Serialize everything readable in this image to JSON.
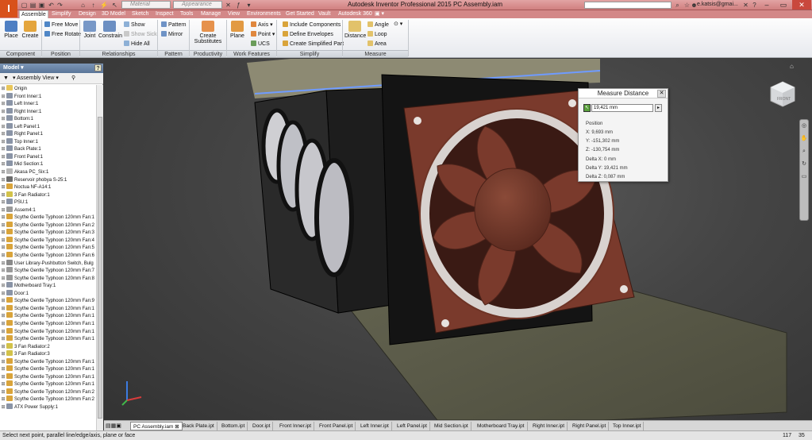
{
  "titlebar": {
    "title": "Autodesk Inventor Professional 2015   PC Assembly.iam",
    "material_placeholder": "Material",
    "appearance_placeholder": "Appearance",
    "user": "e.katsis@gmai...",
    "logo": "I"
  },
  "tabs": [
    "Assemble",
    "Simplify",
    "Design",
    "3D Model",
    "Sketch",
    "Inspect",
    "Tools",
    "Manage",
    "View",
    "Environments",
    "Get Started",
    "Vault",
    "Autodesk 360"
  ],
  "ribbon": {
    "place": "Place",
    "create": "Create",
    "free_move": "Free Move",
    "free_rotate": "Free Rotate",
    "joint": "Joint",
    "constrain": "Constrain",
    "show": "Show",
    "show_sick": "Show Sick",
    "hide_all": "Hide All",
    "pattern": "Pattern",
    "mirror": "Mirror",
    "create_substitutes_1": "Create",
    "create_substitutes_2": "Substitutes",
    "plane": "Plane",
    "axis": "Axis",
    "point": "Point",
    "ucs": "UCS",
    "include_components": "Include Components",
    "define_envelopes": "Define Envelopes",
    "create_simplified_part": "Create Simplified Part",
    "distance": "Distance",
    "angle": "Angle",
    "loop": "Loop",
    "area": "Area",
    "panels": {
      "component": "Component",
      "position": "Position",
      "relationships": "Relationships",
      "pattern": "Pattern",
      "productivity": "Productivity",
      "work_features": "Work Features",
      "simplify": "Simplify",
      "measure": "Measure"
    }
  },
  "browser": {
    "header": "Model",
    "view": "Assembly View",
    "help": "?",
    "nodes": [
      {
        "label": "Origin",
        "color": "#e8c65a"
      },
      {
        "label": "Front Inner:1",
        "color": "#8a94a6"
      },
      {
        "label": "Left Inner:1",
        "color": "#8a94a6"
      },
      {
        "label": "Right Inner:1",
        "color": "#8a94a6"
      },
      {
        "label": "Bottom:1",
        "color": "#8a94a6"
      },
      {
        "label": "Left Panel:1",
        "color": "#8a94a6"
      },
      {
        "label": "Right Panel:1",
        "color": "#8a94a6"
      },
      {
        "label": "Top Inner:1",
        "color": "#8a94a6"
      },
      {
        "label": "Back Plate:1",
        "color": "#8a94a6"
      },
      {
        "label": "Front Panel:1",
        "color": "#8a94a6"
      },
      {
        "label": "Mid Section:1",
        "color": "#8a94a6"
      },
      {
        "label": "Akasa PC_Six:1",
        "color": "#b7b7b7"
      },
      {
        "label": "Reservoir phobya S-25:1",
        "color": "#6d6d6d"
      },
      {
        "label": "Noctua NF-A14:1",
        "color": "#d9a43b"
      },
      {
        "label": "3 Fan Radiator:1",
        "color": "#d2c24a"
      },
      {
        "label": "PSU:1",
        "color": "#8a94a6"
      },
      {
        "label": "Assem4:1",
        "color": "#9a9a9a"
      },
      {
        "label": "Scythe Gentle Typhoon 120mm Fan:1",
        "color": "#d9a43b"
      },
      {
        "label": "Scythe Gentle Typhoon 120mm Fan:2",
        "color": "#d9a43b"
      },
      {
        "label": "Scythe Gentle Typhoon 120mm Fan:3",
        "color": "#d9a43b"
      },
      {
        "label": "Scythe Gentle Typhoon 120mm Fan:4",
        "color": "#d9a43b"
      },
      {
        "label": "Scythe Gentle Typhoon 120mm Fan:5",
        "color": "#d9a43b"
      },
      {
        "label": "Scythe Gentle Typhoon 120mm Fan:6",
        "color": "#d9a43b"
      },
      {
        "label": "User Library-Pushbutton Switch, Bulg",
        "color": "#8a8a8a"
      },
      {
        "label": "Scythe Gentle Typhoon 120mm Fan:7",
        "color": "#9a9a9a"
      },
      {
        "label": "Scythe Gentle Typhoon 120mm Fan:8",
        "color": "#9a9a9a"
      },
      {
        "label": "Motherboard Tray:1",
        "color": "#8a94a6"
      },
      {
        "label": "Door:1",
        "color": "#8a94a6"
      },
      {
        "label": "Scythe Gentle Typhoon 120mm Fan:9",
        "color": "#d9a43b"
      },
      {
        "label": "Scythe Gentle Typhoon 120mm Fan:1",
        "color": "#d9a43b"
      },
      {
        "label": "Scythe Gentle Typhoon 120mm Fan:1",
        "color": "#d9a43b"
      },
      {
        "label": "Scythe Gentle Typhoon 120mm Fan:1",
        "color": "#d9a43b"
      },
      {
        "label": "Scythe Gentle Typhoon 120mm Fan:1",
        "color": "#d9a43b"
      },
      {
        "label": "Scythe Gentle Typhoon 120mm Fan:1",
        "color": "#d9a43b"
      },
      {
        "label": "3 Fan Radiator:2",
        "color": "#d2c24a"
      },
      {
        "label": "3 Fan Radiator:3",
        "color": "#d2c24a"
      },
      {
        "label": "Scythe Gentle Typhoon 120mm Fan:1",
        "color": "#d9a43b"
      },
      {
        "label": "Scythe Gentle Typhoon 120mm Fan:1",
        "color": "#d9a43b"
      },
      {
        "label": "Scythe Gentle Typhoon 120mm Fan:1",
        "color": "#d9a43b"
      },
      {
        "label": "Scythe Gentle Typhoon 120mm Fan:1",
        "color": "#d9a43b"
      },
      {
        "label": "Scythe Gentle Typhoon 120mm Fan:2",
        "color": "#d9a43b"
      },
      {
        "label": "Scythe Gentle Typhoon 120mm Fan:2",
        "color": "#d9a43b"
      },
      {
        "label": "ATX Power Supply:1",
        "color": "#8a94a6"
      }
    ]
  },
  "measure": {
    "title": "Measure Distance",
    "value": "19,421 mm",
    "position_label": "Position",
    "x": "X: 9,693 mm",
    "y": "Y: -151,302 mm",
    "z": "Z: -130,754 mm",
    "dx": "Delta X: 0 mm",
    "dy": "Delta Y: 19,421 mm",
    "dz": "Delta Z: 0,087 mm"
  },
  "viewcube_label": "FRONT",
  "doc_tabs": [
    "PC Assembly.iam",
    "Back Plate.ipt",
    "Bottom.ipt",
    "Door.ipt",
    "Front Inner.ipt",
    "Front Panel.ipt",
    "Left Inner.ipt",
    "Left Panel.ipt",
    "Mid Section.ipt",
    "Motherboard Tray.ipt",
    "Right Inner.ipt",
    "Right Panel.ipt",
    "Top Inner.ipt"
  ],
  "status": {
    "prompt": "Select next point, parallel line/edge/axis, plane or face",
    "n1": "117",
    "n2": "35"
  },
  "colors": {
    "title_bar": "#d17f7f",
    "fan_frame": "#7a3a2c",
    "fan_blade": "#6e3426",
    "accent_blue": "#5b7699"
  }
}
